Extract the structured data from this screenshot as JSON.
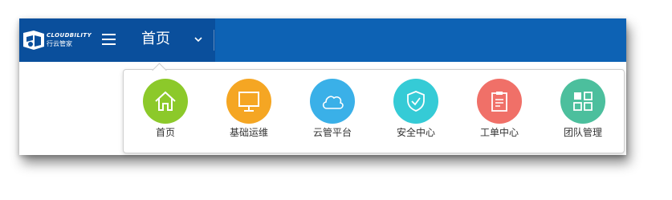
{
  "brand": {
    "name_en": "CLOUDBILITY",
    "name_cn": "行云管家"
  },
  "topbar": {
    "title": "首页",
    "menu_icon": "hamburger-icon",
    "dropdown_icon": "chevron-down-icon"
  },
  "menu": {
    "items": [
      {
        "label": "首页",
        "icon": "home-icon",
        "color": "#8cc92a"
      },
      {
        "label": "基础运维",
        "icon": "monitor-icon",
        "color": "#f5a623"
      },
      {
        "label": "云管平台",
        "icon": "cloud-icon",
        "color": "#3ab0e8"
      },
      {
        "label": "安全中心",
        "icon": "shield-icon",
        "color": "#35cbd6"
      },
      {
        "label": "工单中心",
        "icon": "clipboard-icon",
        "color": "#f07068"
      },
      {
        "label": "团队管理",
        "icon": "grid-icon",
        "color": "#4cbf9d"
      }
    ]
  },
  "colors": {
    "topbar": "#0d62b4",
    "brand_block": "#0a4f9c"
  }
}
